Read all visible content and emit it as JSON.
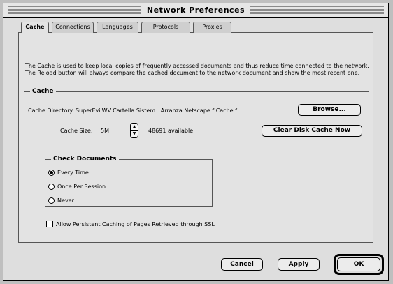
{
  "window": {
    "title": "Network Preferences"
  },
  "tabs": [
    {
      "label": "Cache",
      "active": true
    },
    {
      "label": "Connections",
      "active": false
    },
    {
      "label": "Languages",
      "active": false
    },
    {
      "label": "Protocols",
      "active": false
    },
    {
      "label": "Proxies",
      "active": false
    }
  ],
  "description": "The Cache is used to keep local copies of frequently accessed documents and thus reduce time connected to the network. The Reload button will always compare the cached document to the network document and show the most recent one.",
  "cache": {
    "group_label": "Cache",
    "directory_label": "Cache Directory:",
    "directory_value": "SuperEvilWV:Cartella Sistem...Arranza Netscape f Cache f",
    "browse_label": "Browse...",
    "size_label": "Cache Size:",
    "size_value": "5M",
    "available": "48691 available",
    "clear_label": "Clear Disk Cache Now"
  },
  "check_documents": {
    "group_label": "Check Documents",
    "options": [
      {
        "label": "Every Time",
        "selected": true
      },
      {
        "label": "Once Per Session",
        "selected": false
      },
      {
        "label": "Never",
        "selected": false
      }
    ]
  },
  "ssl_checkbox": {
    "label": "Allow Persistent Caching of Pages Retrieved through SSL",
    "checked": false
  },
  "buttons": {
    "cancel": "Cancel",
    "apply": "Apply",
    "ok": "OK"
  }
}
